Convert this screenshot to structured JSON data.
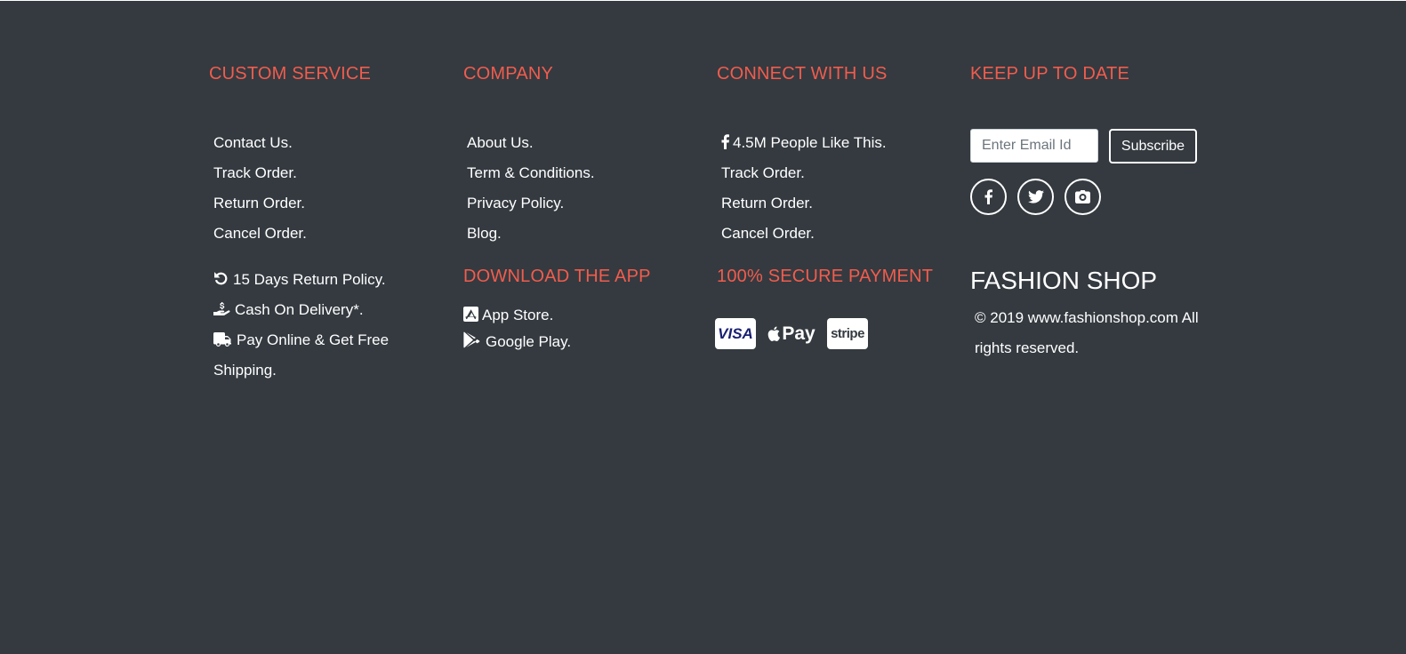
{
  "colors": {
    "background": "#343a40",
    "heading": "#f25c4d",
    "text": "#ffffff"
  },
  "custom_service": {
    "heading": "CUSTOM SERVICE",
    "links": [
      "Contact Us.",
      "Track Order.",
      "Return Order.",
      "Cancel Order."
    ],
    "features": [
      {
        "icon": "undo-icon",
        "label": "15 Days Return Policy."
      },
      {
        "icon": "hand-holding-dollar-icon",
        "label": "Cash On Delivery*."
      },
      {
        "icon": "truck-icon",
        "label": "Pay Online & Get Free Shipping."
      }
    ]
  },
  "company": {
    "heading": "COMPANY",
    "links": [
      "About Us.",
      "Term & Conditions.",
      "Privacy Policy.",
      "Blog."
    ],
    "download_heading": "DOWNLOAD THE APP",
    "apps": [
      {
        "icon": "app-store-icon",
        "label": "App Store."
      },
      {
        "icon": "google-play-icon",
        "label": "Google Play."
      }
    ]
  },
  "connect": {
    "heading": "CONNECT WITH US",
    "links": [
      {
        "icon": "facebook-icon",
        "label": "4.5M People Like This."
      },
      {
        "label": "Track Order."
      },
      {
        "label": "Return Order."
      },
      {
        "label": "Cancel Order."
      }
    ],
    "payment_heading": "100% SECURE PAYMENT",
    "payment_methods": [
      {
        "icon": "visa-icon",
        "label": "VISA"
      },
      {
        "icon": "apple-pay-icon",
        "label": "Pay"
      },
      {
        "icon": "stripe-icon",
        "label": "stripe"
      }
    ]
  },
  "newsletter": {
    "heading": "KEEP UP TO DATE",
    "email_placeholder": "Enter Email Id",
    "subscribe_label": "Subscribe",
    "socials": [
      "facebook-icon",
      "twitter-icon",
      "camera-icon"
    ],
    "brand": "FASHION SHOP",
    "copyright": "© 2019 www.fashionshop.com All rights reserved."
  }
}
